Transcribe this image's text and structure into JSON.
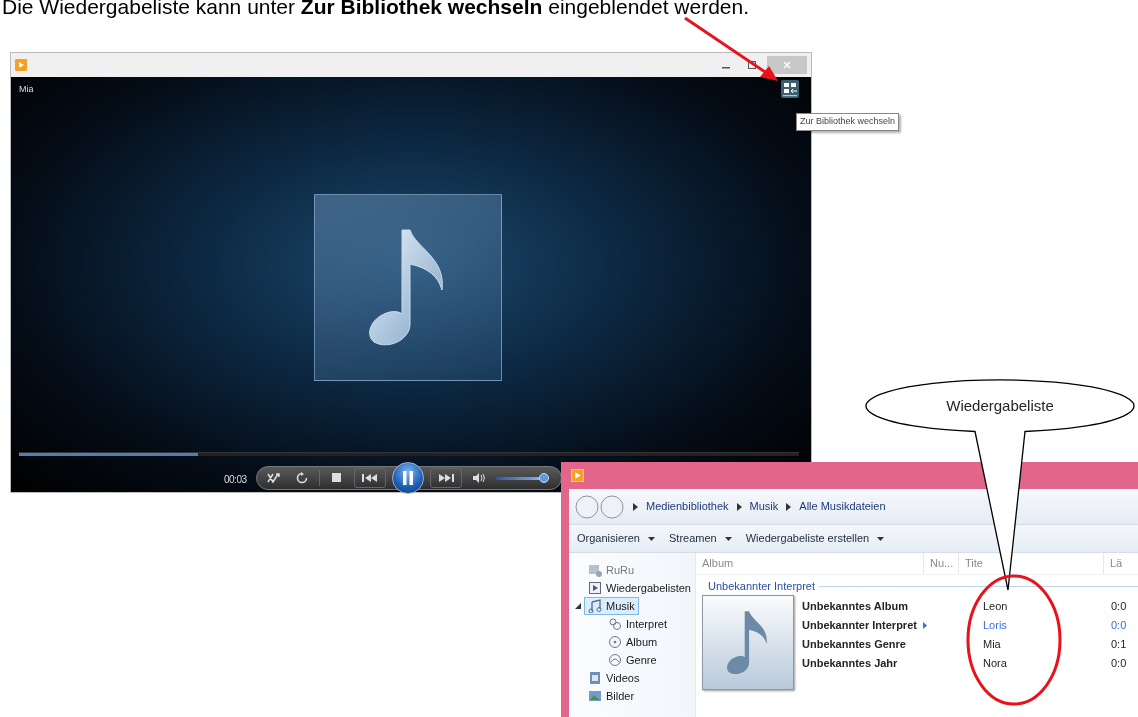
{
  "instruction": "Die Wiedergabeliste kann unter **Zur Bibliothek wechseln** eingeblendet werden.",
  "player": {
    "now_playing": "Mia",
    "switch_tooltip": "Zur Bibliothek wechseln",
    "time": "00:03",
    "playing": true,
    "seek": {
      "level": 0.23
    },
    "volume": {
      "level": 0.95
    }
  },
  "library": {
    "breadcrumb": [
      "Medienbibliothek",
      "Musik",
      "Alle Musikdateien"
    ],
    "toolbar": [
      "Organisieren",
      "Streamen",
      "Wiedergabeliste erstellen"
    ],
    "nav": [
      {
        "label": "RuRu",
        "kind": "user",
        "selected": false,
        "disabled": true
      },
      {
        "label": "Wiedergabelisten",
        "kind": "playlist",
        "selected": false,
        "disabled": false
      },
      {
        "label": "Musik",
        "kind": "music",
        "selected": true,
        "disabled": false,
        "children": [
          {
            "label": "Interpret",
            "kind": "artist",
            "selected": false,
            "disabled": false
          },
          {
            "label": "Album",
            "kind": "album",
            "selected": false,
            "disabled": false
          },
          {
            "label": "Genre",
            "kind": "genre",
            "selected": false,
            "disabled": false
          }
        ]
      },
      {
        "label": "Videos",
        "kind": "video",
        "selected": false,
        "disabled": false
      },
      {
        "label": "Bilder",
        "kind": "picture",
        "selected": false,
        "disabled": false
      }
    ],
    "columns": [
      "Album",
      "Nu...",
      "Tite",
      "Lä"
    ],
    "group": "Unbekannter Interpret",
    "album_info": [
      {
        "text": "Unbekanntes Album",
        "menu": false
      },
      {
        "text": "Unbekannter Interpret",
        "menu": true
      },
      {
        "text": "Unbekanntes Genre",
        "menu": false
      },
      {
        "text": "Unbekanntes Jahr",
        "menu": false
      }
    ],
    "tracks": [
      {
        "title": "Leon",
        "length": "0:0",
        "playing": false
      },
      {
        "title": "Loris",
        "length": "0:0",
        "playing": true
      },
      {
        "title": "Mia",
        "length": "0:1",
        "playing": false
      },
      {
        "title": "Nora",
        "length": "0:0",
        "playing": false
      }
    ]
  },
  "callout": {
    "text": "Wiedergabeliste"
  }
}
